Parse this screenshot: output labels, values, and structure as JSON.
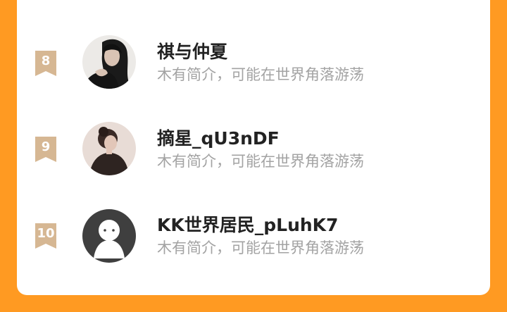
{
  "ranking_list": {
    "items": [
      {
        "rank": "8",
        "name": "祺与仲夏",
        "bio": "木有简介，可能在世界角落游荡",
        "avatar_icon": "photo-avatar-dark-hair"
      },
      {
        "rank": "9",
        "name": "摘星_qU3nDF",
        "bio": "木有简介，可能在世界角落游荡",
        "avatar_icon": "photo-avatar-hair-bun"
      },
      {
        "rank": "10",
        "name": "KK世界居民_pLuhK7",
        "bio": "木有简介，可能在世界角落游荡",
        "avatar_icon": "default-avatar-icon"
      }
    ]
  },
  "colors": {
    "page_background": "#ff9a22",
    "card_background": "#ffffff",
    "rank_badge": "#d6b793",
    "name_text": "#222222",
    "bio_text": "#a3a3a3",
    "default_avatar_bg": "#3f3f3f"
  }
}
